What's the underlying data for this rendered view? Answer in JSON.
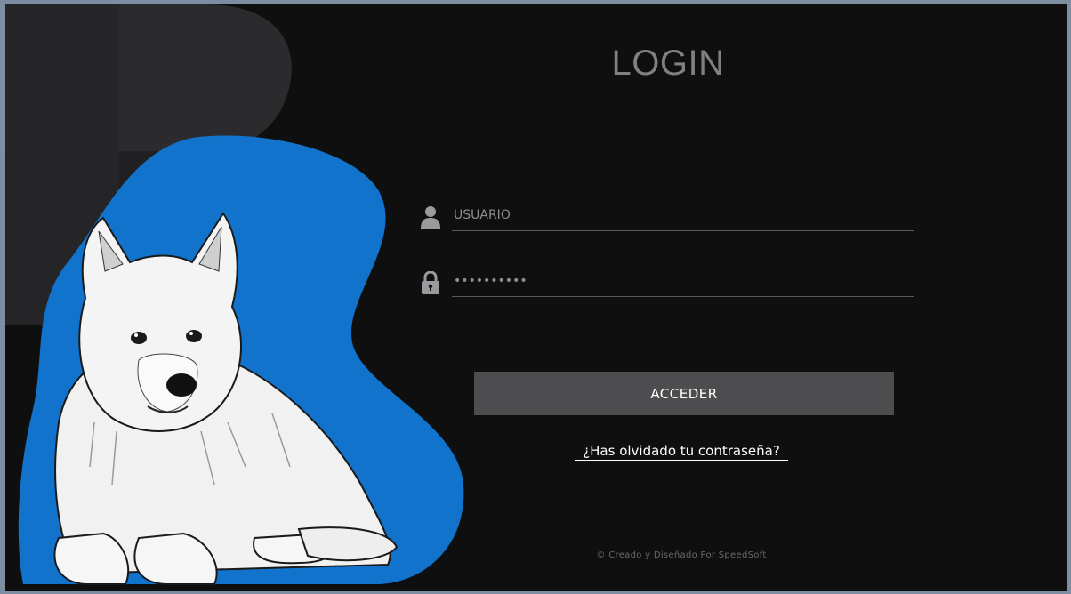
{
  "login": {
    "title": "LOGIN",
    "username_placeholder": "USUARIO",
    "username_icon": "user-icon",
    "password_value": "••••••••••",
    "password_icon": "lock-icon",
    "submit_label": "ACCEDER",
    "forgot_link": "¿Has olvidado tu contraseña?"
  },
  "footer": {
    "credit": "© Creado y Diseñado Por SpeedSoft"
  },
  "colors": {
    "background": "#0f0f10",
    "accent_blob": "#1173cc",
    "button": "#4d4d50",
    "title": "#7f7f84"
  }
}
